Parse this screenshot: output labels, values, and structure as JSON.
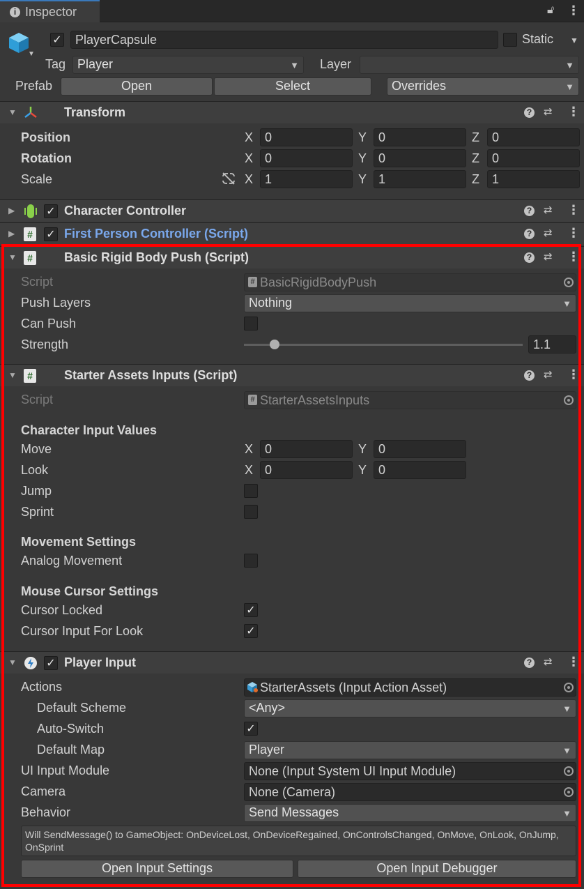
{
  "window": {
    "tab_title": "Inspector"
  },
  "gameobject": {
    "name": "PlayerCapsule",
    "static_label": "Static",
    "tag_label": "Tag",
    "tag_value": "Player",
    "layer_label": "Layer",
    "layer_value": "",
    "prefab_label": "Prefab",
    "open_label": "Open",
    "select_label": "Select",
    "overrides_label": "Overrides"
  },
  "transform": {
    "title": "Transform",
    "position_label": "Position",
    "rotation_label": "Rotation",
    "scale_label": "Scale",
    "axes": [
      "X",
      "Y",
      "Z"
    ],
    "position": [
      "0",
      "0",
      "0"
    ],
    "rotation": [
      "0",
      "0",
      "0"
    ],
    "scale": [
      "1",
      "1",
      "1"
    ]
  },
  "character_controller": {
    "title": "Character Controller"
  },
  "first_person": {
    "title": "First Person Controller (Script)"
  },
  "rigidbody_push": {
    "title": "Basic Rigid Body Push (Script)",
    "script_label": "Script",
    "script_value": "BasicRigidBodyPush",
    "push_layers_label": "Push Layers",
    "push_layers_value": "Nothing",
    "can_push_label": "Can Push",
    "strength_label": "Strength",
    "strength_value": "1.1",
    "strength_fraction": 0.11
  },
  "starter_inputs": {
    "title": "Starter Assets Inputs (Script)",
    "script_label": "Script",
    "script_value": "StarterAssetsInputs",
    "section_input": "Character Input Values",
    "move_label": "Move",
    "look_label": "Look",
    "move": [
      "0",
      "0"
    ],
    "look": [
      "0",
      "0"
    ],
    "jump_label": "Jump",
    "sprint_label": "Sprint",
    "section_movement": "Movement Settings",
    "analog_label": "Analog Movement",
    "section_cursor": "Mouse Cursor Settings",
    "cursor_locked_label": "Cursor Locked",
    "cursor_look_label": "Cursor Input For Look"
  },
  "player_input": {
    "title": "Player Input",
    "actions_label": "Actions",
    "actions_value": "StarterAssets (Input Action Asset)",
    "default_scheme_label": "Default Scheme",
    "default_scheme_value": "<Any>",
    "auto_switch_label": "Auto-Switch",
    "default_map_label": "Default Map",
    "default_map_value": "Player",
    "ui_module_label": "UI Input Module",
    "ui_module_value": "None (Input System UI Input Module)",
    "camera_label": "Camera",
    "camera_value": "None (Camera)",
    "behavior_label": "Behavior",
    "behavior_value": "Send Messages",
    "help_text": "Will SendMessage() to GameObject: OnDeviceLost, OnDeviceRegained, OnControlsChanged, OnMove, OnLook, OnJump, OnSprint",
    "open_settings_label": "Open Input Settings",
    "open_debugger_label": "Open Input Debugger"
  },
  "glyphs": {
    "check": "✓",
    "arrow": "▼",
    "fold_open": "▼",
    "fold_closed": "▶",
    "kebab": "⋮",
    "help": "?"
  }
}
